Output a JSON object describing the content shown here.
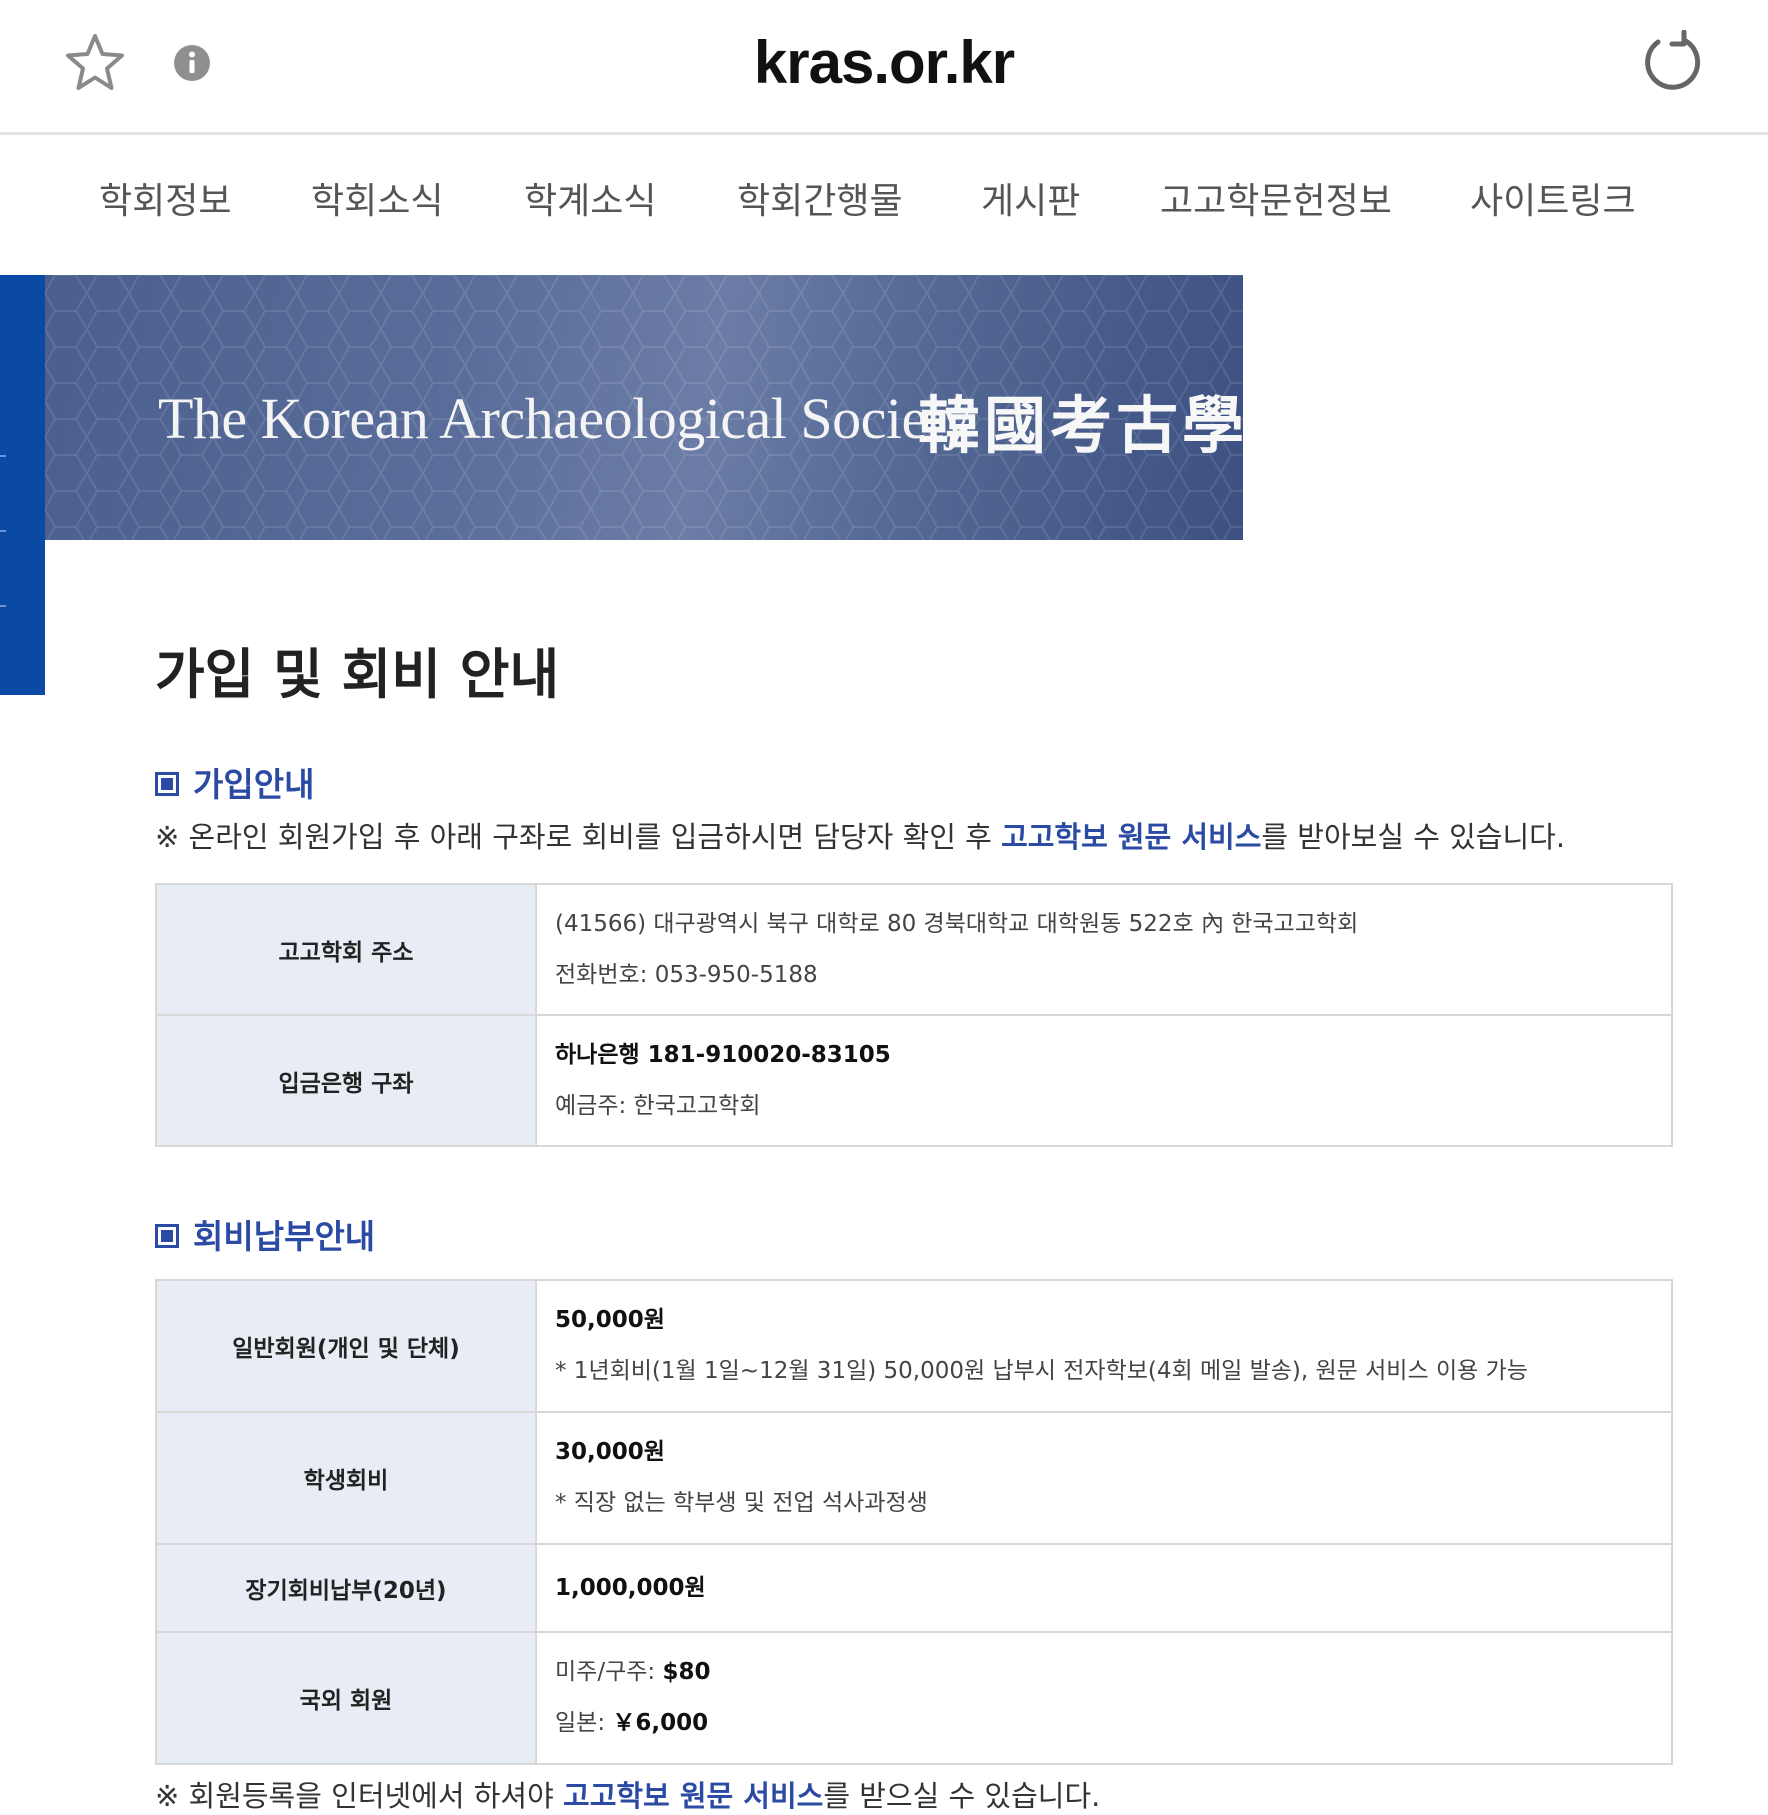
{
  "browser": {
    "domain": "kras.or.kr",
    "star_icon": "star-icon",
    "info_icon": "info-icon",
    "reload_icon": "reload-icon"
  },
  "nav": {
    "items": [
      "학회정보",
      "학회소식",
      "학계소식",
      "학회간행물",
      "게시판",
      "고고학문헌정보",
      "사이트링크"
    ]
  },
  "banner": {
    "english": "The Korean Archaeological Society",
    "hanja": "韓國考古學會"
  },
  "page_title": "가입 및 회비 안내",
  "join": {
    "title": "가입안내",
    "note_prefix": "※ 온라인 회원가입 후 아래 구좌로 회비를 입금하시면 담당자 확인 후 ",
    "note_link": "고고학보 원문 서비스",
    "note_suffix": "를 받아보실 수 있습니다.",
    "rows": [
      {
        "label": "고고학회 주소",
        "line1": "(41566) 대구광역시 북구 대학로 80 경북대학교 대학원동 522호 內 한국고고학회",
        "line2": "전화번호: 053-950-5188"
      },
      {
        "label": "입금은행 구좌",
        "line1": "하나은행  181-910020-83105",
        "line2": "예금주: 한국고고학회"
      }
    ]
  },
  "fees": {
    "title": "회비납부안내",
    "rows": [
      {
        "label": "일반회원(개인 및 단체)",
        "line1": "50,000원",
        "line2": "* 1년회비(1월 1일~12월 31일) 50,000원 납부시 전자학보(4회 메일 발송), 원문 서비스 이용 가능"
      },
      {
        "label": "학생회비",
        "line1": "30,000원",
        "line2": "* 직장 없는 학부생 및 전업 석사과정생"
      },
      {
        "label": "장기회비납부(20년)",
        "line1": "1,000,000원"
      },
      {
        "label": "국외 회원",
        "line1_label": "미주/구주: ",
        "line1_value": "$80",
        "line2_label": "일본: ",
        "line2_value": "￥6,000"
      }
    ],
    "footer_prefix": "※ 회원등록을 인터넷에서 하셔야 ",
    "footer_link": "고고학보 원문 서비스",
    "footer_suffix": "를 받으실 수 있습니다."
  },
  "colors": {
    "accent": "#2b4aa3",
    "sidebar_blue": "#0a4aa4",
    "table_header_bg": "#e8edf5"
  }
}
